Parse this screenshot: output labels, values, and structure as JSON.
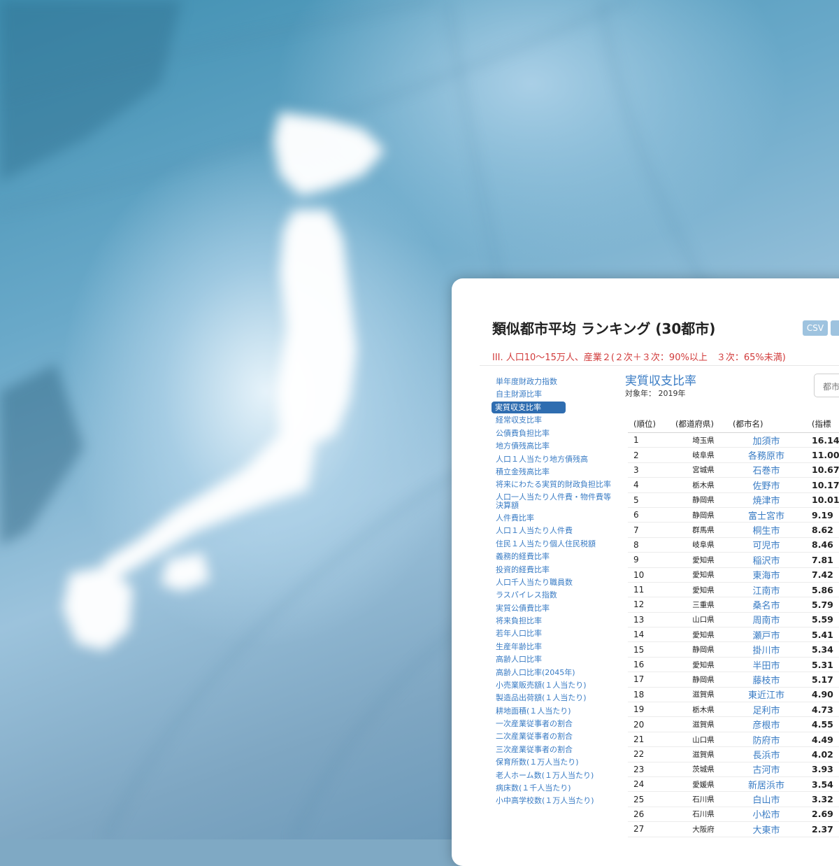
{
  "panel": {
    "title": "類似都市平均 ランキング (30都市)",
    "csv_button": "CSV",
    "subtitle": "III. 人口10〜15万人、産業２(２次＋３次：90%以上　３次：65%未満)"
  },
  "sidebar": {
    "items": [
      {
        "label": "単年度財政力指数"
      },
      {
        "label": "自主財源比率"
      },
      {
        "label": "実質収支比率",
        "active": true
      },
      {
        "label": "経常収支比率"
      },
      {
        "label": "公債費負担比率"
      },
      {
        "label": "地方債残高比率"
      },
      {
        "label": "人口１人当たり地方債残高"
      },
      {
        "label": "積立金残高比率"
      },
      {
        "label": "将来にわたる実質的財政負担比率"
      },
      {
        "label": "人口一人当たり人件費・物件費等決算額"
      },
      {
        "label": "人件費比率"
      },
      {
        "label": "人口１人当たり人件費"
      },
      {
        "label": "住民１人当たり個人住民税額"
      },
      {
        "label": "義務的経費比率"
      },
      {
        "label": "投資的経費比率"
      },
      {
        "label": "人口千人当たり職員数"
      },
      {
        "label": "ラスパイレス指数"
      },
      {
        "label": "実質公債費比率"
      },
      {
        "label": "将来負担比率"
      },
      {
        "label": "若年人口比率"
      },
      {
        "label": "生産年齢比率"
      },
      {
        "label": "高齢人口比率"
      },
      {
        "label": "高齢人口比率(2045年)"
      },
      {
        "label": "小売業販売額(１人当たり)"
      },
      {
        "label": "製造品出荷額(１人当たり)"
      },
      {
        "label": "耕地面積(１人当たり)"
      },
      {
        "label": "一次産業従事者の割合"
      },
      {
        "label": "二次産業従事者の割合"
      },
      {
        "label": "三次産業従事者の割合"
      },
      {
        "label": "保育所数(１万人当たり)"
      },
      {
        "label": "老人ホーム数(１万人当たり)"
      },
      {
        "label": "病床数(１千人当たり)"
      },
      {
        "label": "小中高学校数(１万人当たり)"
      }
    ]
  },
  "main": {
    "metric_title": "実質収支比率",
    "metric_year": "対象年： 2019年",
    "search_placeholder": "都市",
    "headers": {
      "rank": "(順位)",
      "pref": "(都道府県)",
      "city": "(都市名)",
      "value": "(指標"
    },
    "rows": [
      {
        "rank": "1",
        "pref": "埼玉県",
        "city": "加須市",
        "value": "16.14"
      },
      {
        "rank": "2",
        "pref": "岐阜県",
        "city": "各務原市",
        "value": "11.00"
      },
      {
        "rank": "3",
        "pref": "宮城県",
        "city": "石巻市",
        "value": "10.67"
      },
      {
        "rank": "4",
        "pref": "栃木県",
        "city": "佐野市",
        "value": "10.17"
      },
      {
        "rank": "5",
        "pref": "静岡県",
        "city": "焼津市",
        "value": "10.01"
      },
      {
        "rank": "6",
        "pref": "静岡県",
        "city": "富士宮市",
        "value": "9.19"
      },
      {
        "rank": "7",
        "pref": "群馬県",
        "city": "桐生市",
        "value": "8.62"
      },
      {
        "rank": "8",
        "pref": "岐阜県",
        "city": "可児市",
        "value": "8.46"
      },
      {
        "rank": "9",
        "pref": "愛知県",
        "city": "稲沢市",
        "value": "7.81"
      },
      {
        "rank": "10",
        "pref": "愛知県",
        "city": "東海市",
        "value": "7.42"
      },
      {
        "rank": "11",
        "pref": "愛知県",
        "city": "江南市",
        "value": "5.86"
      },
      {
        "rank": "12",
        "pref": "三重県",
        "city": "桑名市",
        "value": "5.79"
      },
      {
        "rank": "13",
        "pref": "山口県",
        "city": "周南市",
        "value": "5.59"
      },
      {
        "rank": "14",
        "pref": "愛知県",
        "city": "瀬戸市",
        "value": "5.41"
      },
      {
        "rank": "15",
        "pref": "静岡県",
        "city": "掛川市",
        "value": "5.34"
      },
      {
        "rank": "16",
        "pref": "愛知県",
        "city": "半田市",
        "value": "5.31"
      },
      {
        "rank": "17",
        "pref": "静岡県",
        "city": "藤枝市",
        "value": "5.17"
      },
      {
        "rank": "18",
        "pref": "滋賀県",
        "city": "東近江市",
        "value": "4.90"
      },
      {
        "rank": "19",
        "pref": "栃木県",
        "city": "足利市",
        "value": "4.73"
      },
      {
        "rank": "20",
        "pref": "滋賀県",
        "city": "彦根市",
        "value": "4.55"
      },
      {
        "rank": "21",
        "pref": "山口県",
        "city": "防府市",
        "value": "4.49"
      },
      {
        "rank": "22",
        "pref": "滋賀県",
        "city": "長浜市",
        "value": "4.02"
      },
      {
        "rank": "23",
        "pref": "茨城県",
        "city": "古河市",
        "value": "3.93"
      },
      {
        "rank": "24",
        "pref": "愛媛県",
        "city": "新居浜市",
        "value": "3.54"
      },
      {
        "rank": "25",
        "pref": "石川県",
        "city": "白山市",
        "value": "3.32"
      },
      {
        "rank": "26",
        "pref": "石川県",
        "city": "小松市",
        "value": "2.69"
      },
      {
        "rank": "27",
        "pref": "大阪府",
        "city": "大東市",
        "value": "2.37"
      }
    ]
  }
}
